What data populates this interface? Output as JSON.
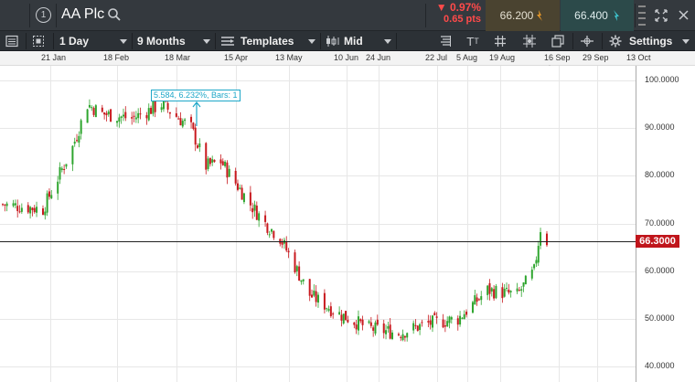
{
  "instrument": {
    "name": "AA Plc",
    "change_pct": "0.97%",
    "change_pts": "0.65 pts"
  },
  "prices": {
    "sell": "66.200",
    "buy": "66.400"
  },
  "toolbar": {
    "interval": "1 Day",
    "range": "9 Months",
    "templates": "Templates",
    "price_type": "Mid",
    "settings": "Settings"
  },
  "icons": {
    "menu": "hamburger-icon",
    "info": "info-circle-icon",
    "search": "search-icon",
    "expand": "expand-icon",
    "close": "close-icon"
  },
  "colors": {
    "up": "#2ea52e",
    "down": "#c8191e",
    "sell_bg": "#4a4330",
    "buy_bg": "#2c4a4a",
    "current_price": "#c0151b"
  },
  "x_ticks": [
    "21 Jan",
    "18 Feb",
    "18 Mar",
    "15 Apr",
    "13 May",
    "10 Jun",
    "24 Jun",
    "22 Jul",
    "5 Aug",
    "19 Aug",
    "16 Sep",
    "29 Sep",
    "13 Oct"
  ],
  "y_ticks": [
    "100.0000",
    "90.0000",
    "80.0000",
    "70.0000",
    "60.0000",
    "50.0000",
    "40.0000"
  ],
  "current_price_label": "66.3000",
  "measure_tooltip": "5.584, 6.232%, Bars: 1",
  "chart_data": {
    "type": "candlestick",
    "y_range": [
      40,
      100
    ],
    "current_price": 66.3,
    "grid": true,
    "close_series": [
      {
        "date": "2019-01-02",
        "close": 74
      },
      {
        "date": "2019-01-21",
        "close": 73
      },
      {
        "date": "2019-02-04",
        "close": 86
      },
      {
        "date": "2019-02-11",
        "close": 95
      },
      {
        "date": "2019-02-18",
        "close": 93
      },
      {
        "date": "2019-03-04",
        "close": 92
      },
      {
        "date": "2019-03-18",
        "close": 95
      },
      {
        "date": "2019-04-01",
        "close": 90
      },
      {
        "date": "2019-04-08",
        "close": 82
      },
      {
        "date": "2019-04-15",
        "close": 83
      },
      {
        "date": "2019-04-29",
        "close": 74
      },
      {
        "date": "2019-05-06",
        "close": 70
      },
      {
        "date": "2019-05-13",
        "close": 67
      },
      {
        "date": "2019-05-27",
        "close": 55
      },
      {
        "date": "2019-06-10",
        "close": 51
      },
      {
        "date": "2019-06-24",
        "close": 48
      },
      {
        "date": "2019-07-08",
        "close": 47
      },
      {
        "date": "2019-07-22",
        "close": 49
      },
      {
        "date": "2019-08-05",
        "close": 50
      },
      {
        "date": "2019-08-19",
        "close": 56
      },
      {
        "date": "2019-09-02",
        "close": 55
      },
      {
        "date": "2019-09-10",
        "close": 60
      },
      {
        "date": "2019-09-13",
        "close": 69
      },
      {
        "date": "2019-09-16",
        "close": 66.3
      }
    ]
  }
}
